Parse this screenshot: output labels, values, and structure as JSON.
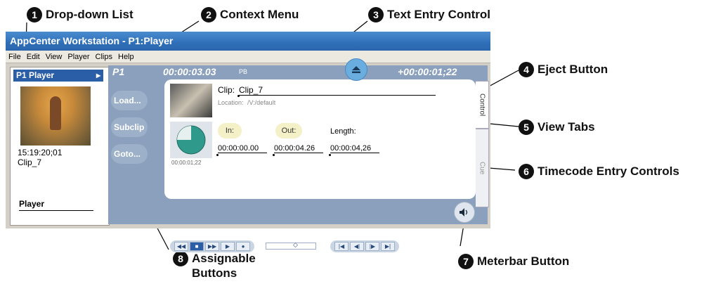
{
  "callouts": [
    {
      "num": "1",
      "label": "Drop-down List"
    },
    {
      "num": "2",
      "label": "Context Menu"
    },
    {
      "num": "3",
      "label": "Text Entry Control"
    },
    {
      "num": "4",
      "label": "Eject Button"
    },
    {
      "num": "5",
      "label": "View Tabs"
    },
    {
      "num": "6",
      "label": "Timecode Entry Controls"
    },
    {
      "num": "7",
      "label": "Meterbar Button"
    },
    {
      "num": "8",
      "label": "Assignable Buttons"
    }
  ],
  "window": {
    "title": "AppCenter Workstation - P1:Player",
    "menu": [
      "File",
      "Edit",
      "View",
      "Player",
      "Clips",
      "Help"
    ]
  },
  "left_panel": {
    "tab_label": "P1 Player",
    "timecode": "15:19:20;01",
    "clip_name": "Clip_7",
    "dropdown_value": "Player"
  },
  "main_panel": {
    "channel": "P1",
    "timecode": "00:00:03.03",
    "mode": "PB",
    "remaining": "+00:00:01;22",
    "clip_label": "Clip:",
    "clip_value": "Clip_7",
    "location_label": "Location:",
    "location_value": "/V:/default",
    "thumb_timecode": "00:00:01;22",
    "in_label": "In:",
    "out_label": "Out:",
    "length_label": "Length:",
    "in_value": "00:00:00.00",
    "out_value": "00:00:04.26",
    "length_value": "00:00:04,26",
    "buttons": [
      "Load...",
      "Subclip",
      "Goto..."
    ],
    "view_tabs": [
      "Control",
      "Cue"
    ]
  },
  "icons": {
    "eject": "eject-icon",
    "meterbar": "speaker-icon"
  }
}
